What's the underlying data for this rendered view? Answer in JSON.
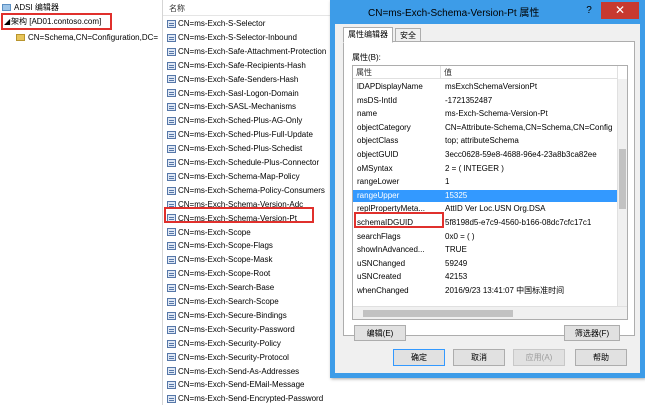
{
  "tree": {
    "root_label": "ADSI 编辑器",
    "connection_label": "架构 [AD01.contoso.com]",
    "schema_node_label": "CN=Schema,CN=Configuration,DC="
  },
  "list": {
    "header": "名称",
    "items": [
      "CN=ms-Exch-S-Selector",
      "CN=ms-Exch-S-Selector-Inbound",
      "CN=ms-Exch-Safe-Attachment-Protection",
      "CN=ms-Exch-Safe-Recipients-Hash",
      "CN=ms-Exch-Safe-Senders-Hash",
      "CN=ms-Exch-Sasl-Logon-Domain",
      "CN=ms-Exch-SASL-Mechanisms",
      "CN=ms-Exch-Sched-Plus-AG-Only",
      "CN=ms-Exch-Sched-Plus-Full-Update",
      "CN=ms-Exch-Sched-Plus-Schedist",
      "CN=ms-Exch-Schedule-Plus-Connector",
      "CN=ms-Exch-Schema-Map-Policy",
      "CN=ms-Exch-Schema-Policy-Consumers",
      "CN=ms-Exch-Schema-Version-Adc",
      "CN=ms-Exch-Schema-Version-Pt",
      "CN=ms-Exch-Scope",
      "CN=ms-Exch-Scope-Flags",
      "CN=ms-Exch-Scope-Mask",
      "CN=ms-Exch-Scope-Root",
      "CN=ms-Exch-Search-Base",
      "CN=ms-Exch-Search-Scope",
      "CN=ms-Exch-Secure-Bindings",
      "CN=ms-Exch-Security-Password",
      "CN=ms-Exch-Security-Policy",
      "CN=ms-Exch-Security-Protocol",
      "CN=ms-Exch-Send-As-Addresses",
      "CN=ms-Exch-Send-EMail-Message",
      "CN=ms-Exch-Send-Encrypted-Password"
    ],
    "selected_index": 14
  },
  "dialog": {
    "title": "CN=ms-Exch-Schema-Version-Pt 属性",
    "help_glyph": "?",
    "close_glyph": "✕",
    "tabs": [
      "属性编辑器",
      "安全"
    ],
    "attributes_label": "属性(B):",
    "col_attribute": "属性",
    "col_value": "值",
    "rows": [
      {
        "name": "lDAPDisplayName",
        "value": "msExchSchemaVersionPt"
      },
      {
        "name": "msDS-IntId",
        "value": "-1721352487"
      },
      {
        "name": "name",
        "value": "ms-Exch-Schema-Version-Pt"
      },
      {
        "name": "objectCategory",
        "value": "CN=Attribute-Schema,CN=Schema,CN=Config"
      },
      {
        "name": "objectClass",
        "value": "top; attributeSchema"
      },
      {
        "name": "objectGUID",
        "value": "3ecc0628-59e8-4688-96e4-23a8b3ca82ee"
      },
      {
        "name": "oMSyntax",
        "value": "2 = ( INTEGER )"
      },
      {
        "name": "rangeLower",
        "value": "1"
      },
      {
        "name": "rangeUpper",
        "value": "15325"
      },
      {
        "name": "replPropertyMeta...",
        "value": "AttID  Ver    Loc.USN              Org.DSA"
      },
      {
        "name": "schemaIDGUID",
        "value": "5f8198d5-e7c9-4560-b166-08dc7cfc17c1"
      },
      {
        "name": "searchFlags",
        "value": "0x0 = ( )"
      },
      {
        "name": "showInAdvanced...",
        "value": "TRUE"
      },
      {
        "name": "uSNChanged",
        "value": "59249"
      },
      {
        "name": "uSNCreated",
        "value": "42153"
      },
      {
        "name": "whenChanged",
        "value": "2016/9/23 13:41:07 中国标准时间"
      }
    ],
    "selected_row": 8,
    "edit_button": "编辑(E)",
    "filter_button": "筛选器(F)",
    "ok_button": "确定",
    "cancel_button": "取消",
    "apply_button": "应用(A)",
    "help_button": "帮助"
  },
  "colors": {
    "dialog_frame": "#3d9ce8",
    "selection": "#3399ff",
    "highlight_box": "#e0302c",
    "close_button": "#c7392f"
  }
}
